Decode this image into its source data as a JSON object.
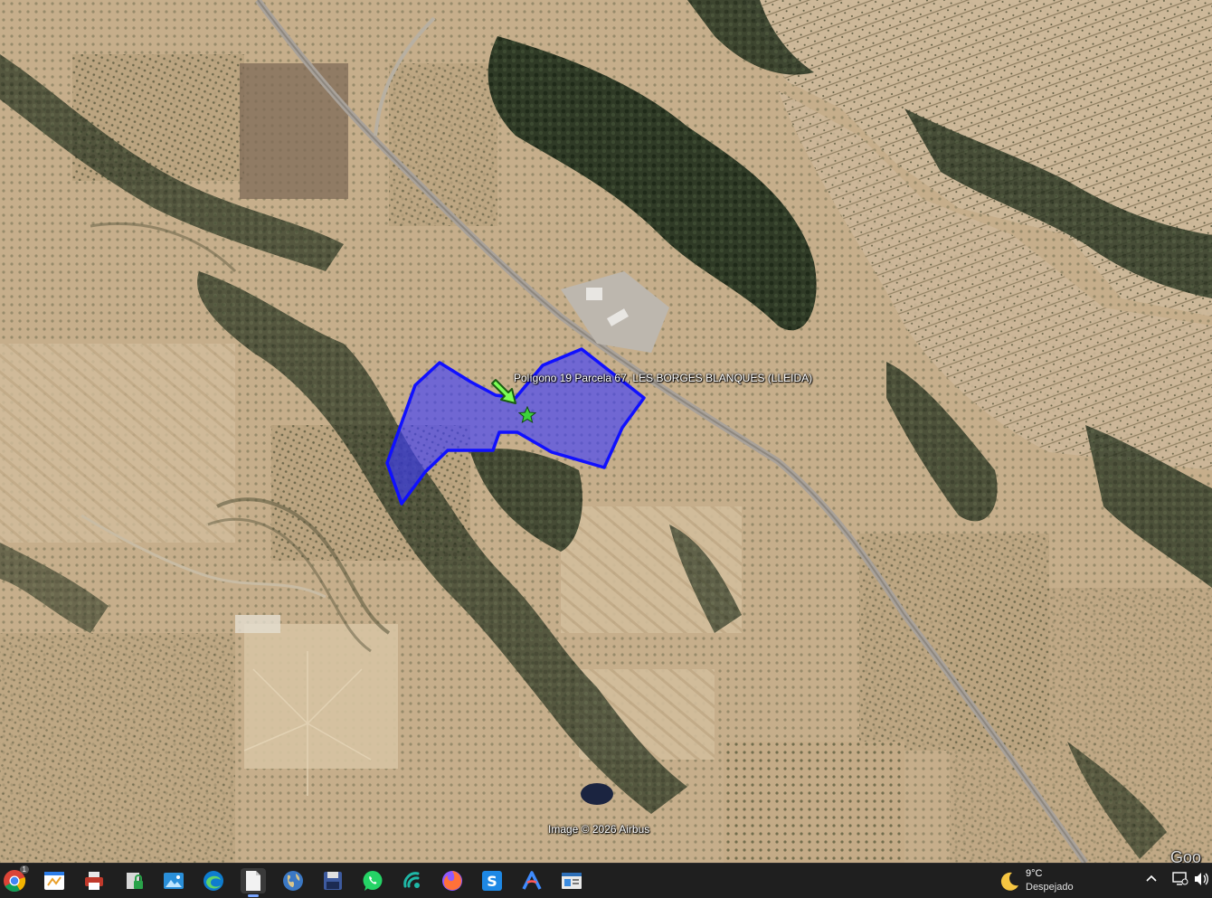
{
  "map": {
    "parcel_label": "Polígono 19 Parcela 67, LES BORGES BLANQUES (LLEIDA)",
    "copyright": "Image © 2026 Airbus",
    "logo": "Goo",
    "parcel_fill_color": "#3b3bff",
    "parcel_stroke_color": "#1010ff",
    "arrow_color": "#7cff55",
    "marker_color": "#3cd13c"
  },
  "taskbar": {
    "icons": [
      {
        "name": "chrome-icon"
      },
      {
        "name": "whiteboard-icon"
      },
      {
        "name": "printer-icon"
      },
      {
        "name": "lock-file-icon"
      },
      {
        "name": "photos-icon"
      },
      {
        "name": "edge-icon"
      },
      {
        "name": "document-icon"
      },
      {
        "name": "earth-icon"
      },
      {
        "name": "save-disk-icon"
      },
      {
        "name": "whatsapp-icon"
      },
      {
        "name": "signal-icon"
      },
      {
        "name": "firefox-icon"
      },
      {
        "name": "scan-s-icon"
      },
      {
        "name": "arc-icon"
      },
      {
        "name": "window-app-icon"
      }
    ],
    "chrome_badge": "1",
    "weather": {
      "temperature": "9°C",
      "condition": "Despejado"
    }
  }
}
